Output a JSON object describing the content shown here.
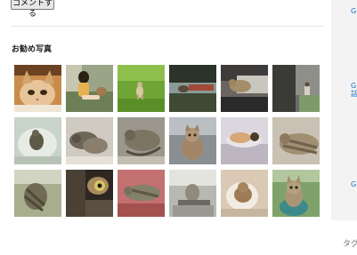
{
  "comment_button_label": "コメントする",
  "section_title": "お勧め写真",
  "sidebar": {
    "links": [
      {
        "label": "Gi"
      },
      {
        "label": "G"
      },
      {
        "label": "話"
      },
      {
        "label": "G"
      }
    ],
    "tag_label": "タグ"
  },
  "photos": [
    {
      "subject": "cat face close-up"
    },
    {
      "subject": "child with cat"
    },
    {
      "subject": "cat on lawn"
    },
    {
      "subject": "cat at pond"
    },
    {
      "subject": "cat sleeping on sofa"
    },
    {
      "subject": "cat in doorway"
    },
    {
      "subject": "cat on cushion"
    },
    {
      "subject": "cats curled together"
    },
    {
      "subject": "sleeping tabby"
    },
    {
      "subject": "cat at window"
    },
    {
      "subject": "cat on blanket"
    },
    {
      "subject": "cat lying down"
    },
    {
      "subject": "cat stretching"
    },
    {
      "subject": "cat eye close-up"
    },
    {
      "subject": "cat on red cushion"
    },
    {
      "subject": "cat on chair"
    },
    {
      "subject": "cat in towel"
    },
    {
      "subject": "tabby on stool"
    }
  ]
}
